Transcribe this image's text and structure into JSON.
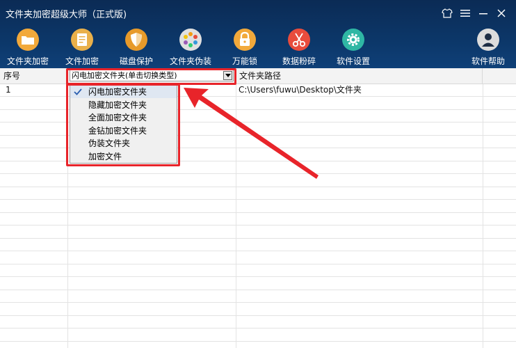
{
  "window": {
    "title": "文件夹加密超级大师（正式版)",
    "controls": [
      {
        "icon": "shirt-icon"
      },
      {
        "icon": "menu-icon"
      },
      {
        "icon": "minimize-icon"
      },
      {
        "icon": "close-icon"
      }
    ]
  },
  "toolbar": {
    "items": [
      {
        "label": "文件夹加密",
        "icon": "folder-icon",
        "color": "#f2a93b"
      },
      {
        "label": "文件加密",
        "icon": "document-icon",
        "color": "#e9b04a"
      },
      {
        "label": "磁盘保护",
        "icon": "shield-icon",
        "color": "#e79a2a"
      },
      {
        "label": "文件夹伪装",
        "icon": "palette-icon",
        "color": "#e0e0e0"
      },
      {
        "label": "万能锁",
        "icon": "padlock-icon",
        "color": "#f2a93b"
      },
      {
        "label": "数据粉碎",
        "icon": "scissors-icon",
        "color": "#e84c3d"
      },
      {
        "label": "软件设置",
        "icon": "gear-icon",
        "color": "#2fb7a4"
      },
      {
        "label": "软件帮助",
        "icon": "user-help-icon",
        "color": "#dcdcdc"
      }
    ]
  },
  "table": {
    "headers": {
      "seq": "序号",
      "type_select": "闪电加密文件夹(单击切换类型)",
      "path": "文件夹路径"
    },
    "rows": [
      {
        "seq": "1",
        "path": "C:\\Users\\fuwu\\Desktop\\文件夹"
      }
    ]
  },
  "dropdown": {
    "options": [
      {
        "label": "闪电加密文件夹",
        "selected": true
      },
      {
        "label": "隐藏加密文件夹",
        "selected": false
      },
      {
        "label": "全面加密文件夹",
        "selected": false
      },
      {
        "label": "金钻加密文件夹",
        "selected": false
      },
      {
        "label": "伪装文件夹",
        "selected": false
      },
      {
        "label": "加密文件",
        "selected": false
      }
    ]
  },
  "colors": {
    "header_bg": "#0c3769",
    "highlight": "#e8242a",
    "selected_option_bg": "#dfe7f2"
  }
}
